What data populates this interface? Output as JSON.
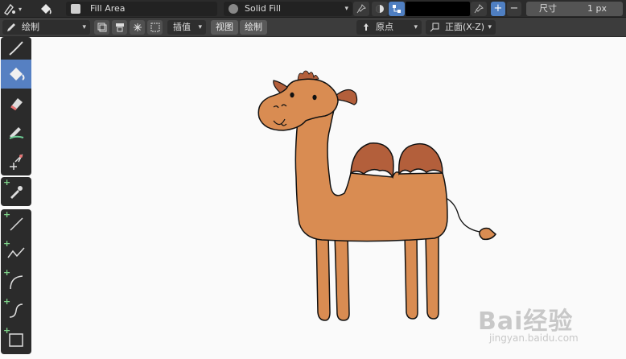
{
  "topbar": {
    "layer_name": "Fill Area",
    "material_name": "Solid Fill",
    "size_label": "尺寸",
    "size_value": "1 px",
    "plus_label": "+",
    "minus_label": "−"
  },
  "header": {
    "mode_label": "绘制",
    "interpolate_label": "插值",
    "view_menu": "视图",
    "draw_menu": "绘制",
    "origin_label": "原点",
    "orientation_label": "正面(X-Z)"
  },
  "toolbar": {
    "tools": [
      "draw",
      "fill",
      "erase",
      "tint",
      "cutter",
      "eyedropper",
      "line",
      "polyline",
      "arc",
      "curve",
      "box"
    ],
    "active_tool": "fill"
  },
  "watermark": {
    "brand_text": "Bai经验",
    "url_text": "jingyan.baidu.com"
  },
  "colors": {
    "camel_body": "#d98c52",
    "camel_humps": "#b35f3b",
    "active_tool": "#5680c2",
    "outline": "#111111"
  }
}
